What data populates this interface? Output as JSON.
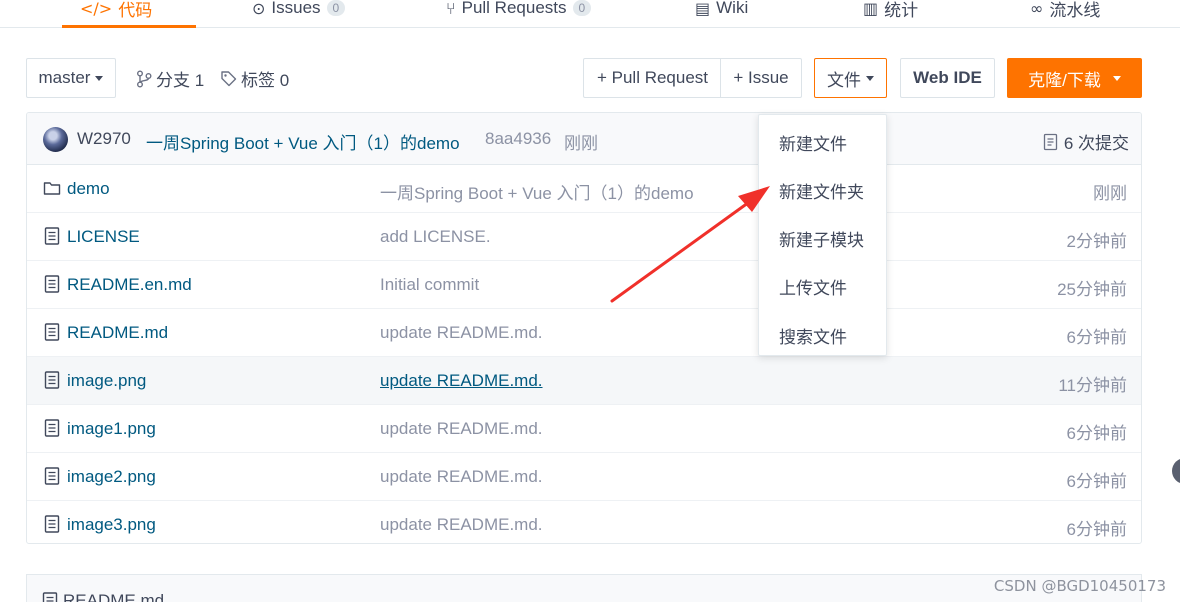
{
  "top_tabs": [
    {
      "label": "代码",
      "icon": "code-icon",
      "active": true
    },
    {
      "label": "Issues",
      "count": "0",
      "icon": "issues-icon"
    },
    {
      "label": "Pull Requests",
      "count": "0",
      "icon": "pull-request-icon"
    },
    {
      "label": "Wiki",
      "icon": "wiki-icon"
    },
    {
      "label": "统计",
      "icon": "stats-icon"
    },
    {
      "label": "流水线",
      "icon": "pipeline-icon"
    }
  ],
  "toolbar": {
    "branch": "master",
    "branches": "分支 1",
    "tags": "标签 0",
    "pull_request": "+ Pull Request",
    "issue": "+ Issue",
    "file_menu": "文件",
    "web_ide": "Web IDE",
    "clone": "克隆/下载"
  },
  "commit": {
    "author": "W2970",
    "message": "一周Spring Boot + Vue 入门（1）的demo",
    "hash": "8aa4936",
    "time": "刚刚",
    "count": "6 次提交"
  },
  "files": [
    {
      "name": "demo",
      "type": "folder",
      "message": "一周Spring Boot + Vue 入门（1）的demo",
      "time": "刚刚"
    },
    {
      "name": "LICENSE",
      "type": "file",
      "message": "add LICENSE.",
      "time": "2分钟前"
    },
    {
      "name": "README.en.md",
      "type": "file",
      "message": "Initial commit",
      "time": "25分钟前"
    },
    {
      "name": "README.md",
      "type": "file",
      "message": "update README.md.",
      "time": "6分钟前"
    },
    {
      "name": "image.png",
      "type": "file",
      "message": "update README.md.",
      "time": "11分钟前"
    },
    {
      "name": "image1.png",
      "type": "file",
      "message": "update README.md.",
      "time": "6分钟前"
    },
    {
      "name": "image2.png",
      "type": "file",
      "message": "update README.md.",
      "time": "6分钟前"
    },
    {
      "name": "image3.png",
      "type": "file",
      "message": "update README.md.",
      "time": "6分钟前"
    }
  ],
  "file_dropdown": {
    "items": [
      "新建文件",
      "新建文件夹",
      "新建子模块",
      "上传文件",
      "搜索文件"
    ]
  },
  "readme": {
    "title": "README.md"
  },
  "watermark": "CSDN @BGD10450173",
  "colors": {
    "accent": "#fe7300",
    "link": "#005980",
    "muted": "#8c92a4",
    "annotation_arrow": "#f0302a"
  }
}
